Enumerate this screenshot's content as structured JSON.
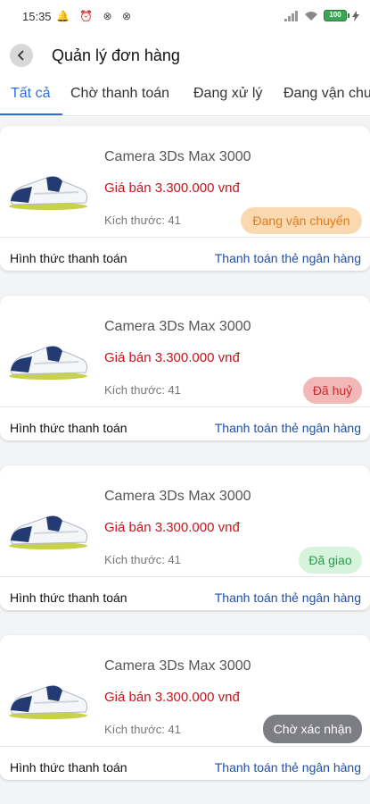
{
  "status_bar": {
    "time": "15:35",
    "left_icons": "🔔 ⏰ ⊗ ⊗",
    "battery": "100"
  },
  "header": {
    "title": "Quản lý đơn hàng"
  },
  "tabs": [
    {
      "label": "Tất cả"
    },
    {
      "label": "Chờ thanh toán"
    },
    {
      "label": "Đang xử lý"
    },
    {
      "label": "Đang vận chu"
    }
  ],
  "orders": [
    {
      "name": "Camera 3Ds Max 3000",
      "price": "Giá bán 3.300.000 vnđ",
      "size": "Kích thước: 41",
      "status": "Đang vận chuyển",
      "status_bg": "#fbd9b0",
      "status_color": "#e07b16",
      "payment_label": "Hình thức thanh toán",
      "payment_value": "Thanh toán thẻ ngân hàng"
    },
    {
      "name": "Camera 3Ds Max 3000",
      "price": "Giá bán 3.300.000 vnđ",
      "size": "Kích thước: 41",
      "status": "Đã huỷ",
      "status_bg": "#f2b7b7",
      "status_color": "#c92a2a",
      "payment_label": "Hình thức thanh toán",
      "payment_value": "Thanh toán thẻ ngân hàng"
    },
    {
      "name": "Camera 3Ds Max 3000",
      "price": "Giá bán 3.300.000 vnđ",
      "size": "Kích thước: 41",
      "status": "Đã giao",
      "status_bg": "#d6f3dc",
      "status_color": "#2b9a4a",
      "payment_label": "Hình thức thanh toán",
      "payment_value": "Thanh toán thẻ ngân hàng"
    },
    {
      "name": "Camera 3Ds Max 3000",
      "price": "Giá bán 3.300.000 vnđ",
      "size": "Kích thước: 41",
      "status": "Chờ xác nhận",
      "status_bg": "#7d7d86",
      "status_color": "#ffffff",
      "payment_label": "Hình thức thanh toán",
      "payment_value": "Thanh toán thẻ ngân hàng"
    }
  ]
}
